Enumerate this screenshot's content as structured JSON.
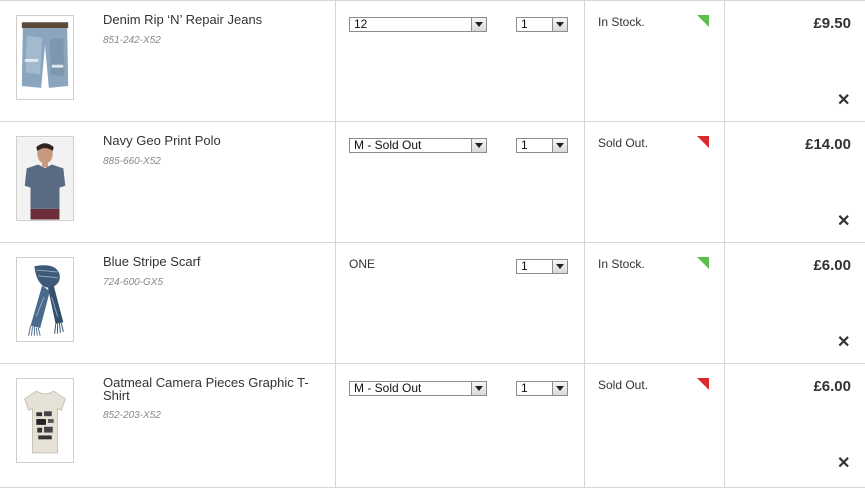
{
  "bag": {
    "items": [
      {
        "name": "Denim Rip ‘N’ Repair Jeans",
        "code": "851-242-X52",
        "size": "12",
        "qty": "1",
        "stock": "In Stock.",
        "stock_color": "#5cbf4a",
        "price": "£9.50",
        "remove": "✕"
      },
      {
        "name": "Navy Geo Print Polo",
        "code": "885-660-X52",
        "size": "M - Sold Out",
        "qty": "1",
        "stock": "Sold Out.",
        "stock_color": "#d92b2b",
        "price": "£14.00",
        "remove": "✕"
      },
      {
        "name": "Blue Stripe Scarf",
        "code": "724-600-GX5",
        "size": "ONE",
        "qty": "1",
        "stock": "In Stock.",
        "stock_color": "#5cbf4a",
        "price": "£6.00",
        "remove": "✕"
      },
      {
        "name": "Oatmeal Camera Pieces Graphic T-Shirt",
        "code": "852-203-X52",
        "size": "M - Sold Out",
        "qty": "1",
        "stock": "Sold Out.",
        "stock_color": "#d92b2b",
        "price": "£6.00",
        "remove": "✕"
      }
    ]
  }
}
